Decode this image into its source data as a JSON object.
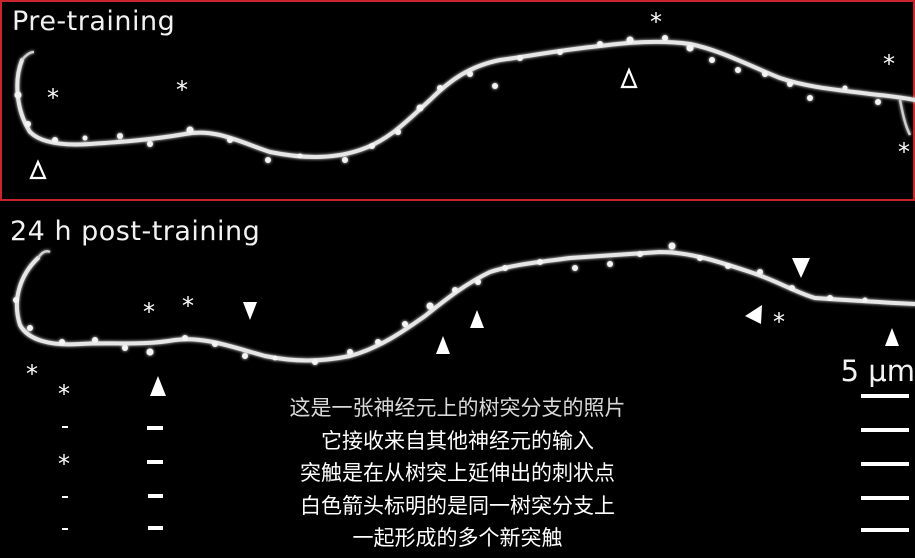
{
  "image": {
    "panels": {
      "pre": {
        "label": "Pre-training",
        "border_color": "#c8262c"
      },
      "post": {
        "label": "24 h post-training"
      }
    },
    "scale_bar": {
      "label": "5 μm"
    },
    "markers": {
      "asterisk": "*",
      "open_triangle": "Δ"
    },
    "subtitles": [
      "这是一张神经元上的树突分支的照片",
      "它接收来自其他神经元的输入",
      "突触是在从树突上延伸出的刺状点",
      "白色箭头标明的是同一树突分支上",
      "一起形成的多个新突触"
    ]
  }
}
